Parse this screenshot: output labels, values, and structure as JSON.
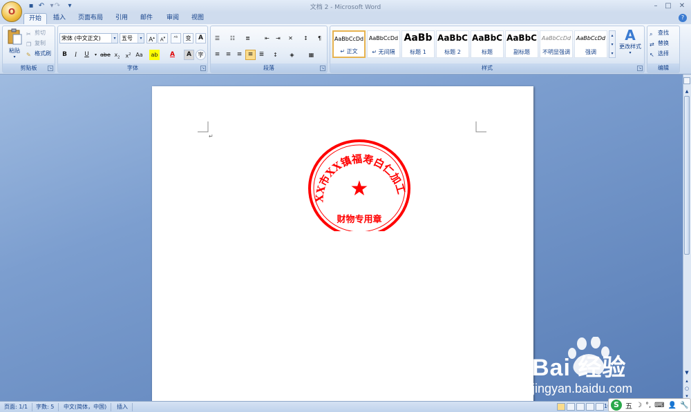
{
  "window": {
    "title": "文档 2 - Microsoft Word",
    "office_button": "O"
  },
  "quick_access": {
    "save_icon": "save-icon",
    "undo_icon": "undo-icon",
    "redo_icon": "redo-icon",
    "customize_icon": "customize-icon"
  },
  "tabs": [
    "开始",
    "插入",
    "页面布局",
    "引用",
    "邮件",
    "审阅",
    "视图"
  ],
  "active_tab": "开始",
  "clipboard": {
    "paste": "粘贴",
    "cut": "剪切",
    "copy": "复制",
    "format_painter": "格式刷",
    "label": "剪贴板"
  },
  "font": {
    "family": "宋体 (中文正文)",
    "size": "五号",
    "label": "字体"
  },
  "paragraph": {
    "label": "段落"
  },
  "styles": {
    "label": "样式",
    "items": [
      {
        "sample": "AaBbCcDd",
        "name": "↵ 正文"
      },
      {
        "sample": "AaBbCcDd",
        "name": "↵ 无间隔"
      },
      {
        "sample": "AaBb",
        "name": "标题 1"
      },
      {
        "sample": "AaBbC",
        "name": "标题 2"
      },
      {
        "sample": "AaBbC",
        "name": "标题"
      },
      {
        "sample": "AaBbC",
        "name": "副标题"
      },
      {
        "sample": "AaBbCcDd",
        "name": "不明显强调"
      },
      {
        "sample": "AaBbCcDd",
        "name": "强调"
      }
    ],
    "change_styles": "更改样式"
  },
  "editing": {
    "find": "查找",
    "replace": "替换",
    "select": "选择",
    "label": "编辑"
  },
  "document": {
    "paragraph_mark": "↵",
    "seal": {
      "org_text": "XX市XX镇福寿白仁加工厂",
      "bottom_text": "财物专用章",
      "star": "★",
      "color": "#ff0000"
    }
  },
  "status": {
    "page": "页面: 1/1",
    "words": "字数: 5",
    "language": "中文(简体，中国)",
    "mode": "插入",
    "zoom": "100%"
  },
  "ime": {
    "logo": "S",
    "mode": "五",
    "moon": "☽",
    "dot": "°,",
    "keyboard": "⌨",
    "user": "👤",
    "settings": "🔧"
  },
  "watermark": {
    "brand": "Bai 经验",
    "url": "jingyan.baidu.com"
  }
}
